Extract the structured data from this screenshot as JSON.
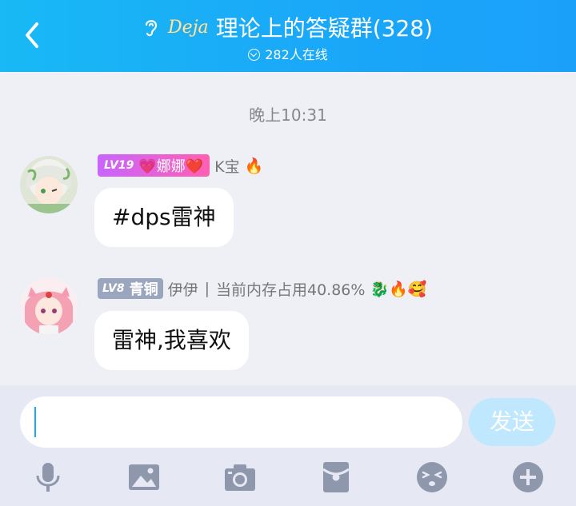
{
  "header": {
    "brand": "Deja",
    "title": "理论上的答疑群(328)",
    "online": "282人在线"
  },
  "chat": {
    "timestamp": "晚上10:31",
    "messages": [
      {
        "level": "LV19",
        "title": "💗娜娜❤️",
        "name": "K宝",
        "emojis": "🔥",
        "text": "#dps雷神"
      },
      {
        "level": "LV8",
        "title": "青铜",
        "name": "伊伊",
        "separator": "|",
        "status": "当前内存占用40.86%",
        "emojis": "🐉🔥🥰",
        "text": "雷神,我喜欢"
      }
    ]
  },
  "input": {
    "value": "",
    "send_label": "发送"
  },
  "toolbar": [
    "mic-icon",
    "image-icon",
    "camera-icon",
    "red-packet-icon",
    "emoji-icon",
    "plus-icon"
  ],
  "colors": {
    "header_start": "#18b9f5",
    "header_end": "#1ba0fa",
    "background": "#eef0f6",
    "send_disabled": "#bfe8ff",
    "icon": "#8e97ac"
  }
}
